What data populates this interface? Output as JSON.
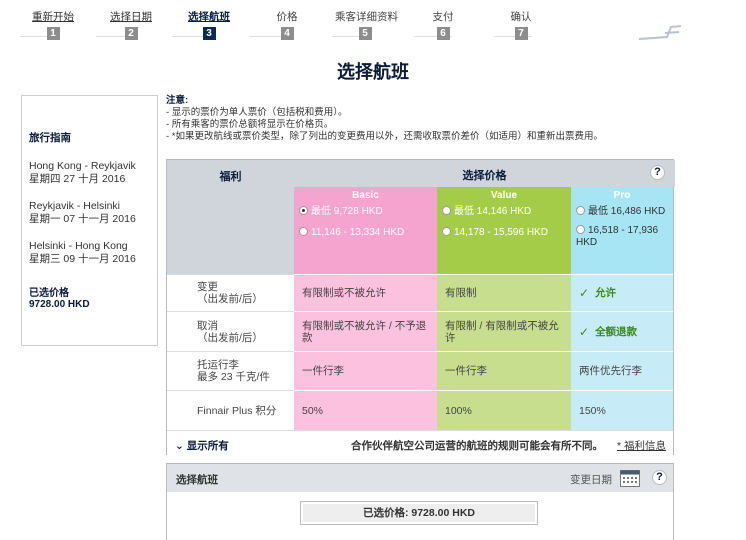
{
  "steps": [
    {
      "label": "重新开始",
      "number": "1"
    },
    {
      "label": "选择日期",
      "number": "2"
    },
    {
      "label": "选择航班",
      "number": "3"
    },
    {
      "label": "价格",
      "number": "4"
    },
    {
      "label": "乘客详细资料",
      "number": "5"
    },
    {
      "label": "支付",
      "number": "6"
    },
    {
      "label": "确认",
      "number": "7"
    }
  ],
  "page_title": "选择航班",
  "sidebar": {
    "title": "旅行指南",
    "routes": [
      {
        "route": "Hong Kong - Reykjavik",
        "date": "星期四 27 十月 2016"
      },
      {
        "route": "Reykjavik - Helsinki",
        "date": "星期一 07 十一月 2016"
      },
      {
        "route": "Helsinki - Hong Kong",
        "date": "星期三 09 十一月 2016"
      }
    ],
    "selected_label": "已选价格",
    "selected_value": "9728.00 HKD"
  },
  "notes": {
    "title": "注意:",
    "lines": [
      "- 显示的票价为单人票价（包括税和费用）。",
      "- 所有乘客的票价总额将显示在价格页。",
      "- *如果更改航线或票价类型，除了列出的变更费用以外，还需收取票价差价（如适用）和重新出票费用。"
    ]
  },
  "fare_table": {
    "benefits_header": "福利",
    "price_header": "选择价格",
    "help_icon": "?",
    "families": [
      {
        "name": "Basic",
        "options": [
          "最低 9,728 HKD",
          "11,146 - 13,334 HKD"
        ]
      },
      {
        "name": "Value",
        "options": [
          "最低 14,146 HKD",
          "14,178 - 15,596 HKD"
        ]
      },
      {
        "name": "Pro",
        "options": [
          "最低 16,486 HKD",
          "16,518 - 17,936 HKD"
        ]
      }
    ],
    "rows": [
      {
        "label": "变更\n（出发前/后）",
        "basic": "有限制或不被允许",
        "value": "有限制",
        "pro": "允许"
      },
      {
        "label": "取消\n（出发前/后）",
        "basic": "有限制或不被允许 / 不予退款",
        "value": "有限制 / 有限制或不被允许",
        "pro": "全额退款"
      },
      {
        "label": "托运行李\n最多 23 千克/件",
        "basic": "一件行李",
        "value": "一件行李",
        "pro": "两件优先行李"
      },
      {
        "label": "Finnair Plus 积分",
        "basic": "50%",
        "value": "100%",
        "pro": "150%"
      }
    ],
    "show_all": "显示所有",
    "partner_note": "合作伙伴航空公司运营的航班的规则可能会有所不同。",
    "rules_link": "* 福利信息"
  },
  "select_panel": {
    "title": "选择航班",
    "change_date": "变更日期",
    "selected_price": "已选价格: 9728.00 HKD"
  },
  "colors": {
    "basic": "#f5a3cf",
    "value": "#a5cc48",
    "pro": "#a7e4f4",
    "navy": "#0b2a57"
  }
}
